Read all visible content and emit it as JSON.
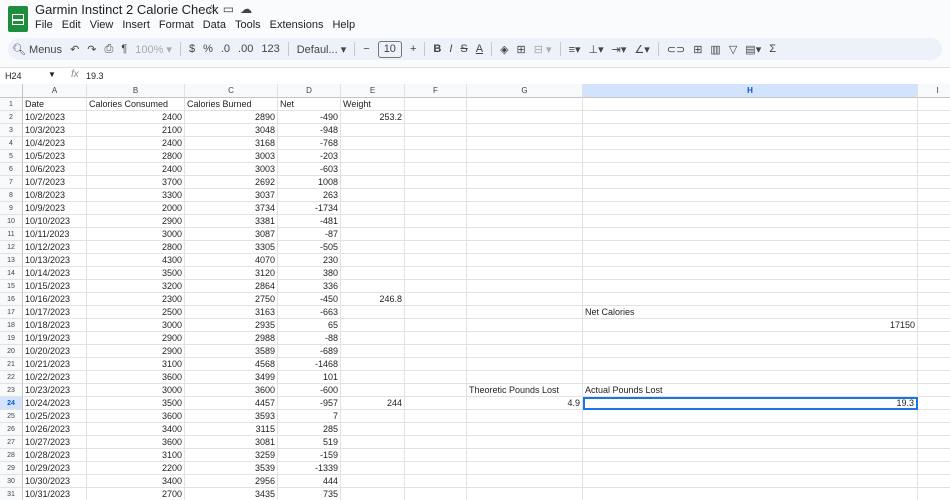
{
  "app": {
    "title": "Garmin Instinct 2 Calorie Check",
    "menu": [
      "File",
      "Edit",
      "View",
      "Insert",
      "Format",
      "Data",
      "Tools",
      "Extensions",
      "Help"
    ]
  },
  "toolbar": {
    "menus": "Menus",
    "zoom": "100%",
    "currency": "$",
    "percent": "%",
    "dec_decrease": ".0",
    "dec_increase": ".00",
    "number_format": "123",
    "font": "Defaul...",
    "minus": "−",
    "font_size": "10",
    "plus": "+",
    "bold": "B",
    "italic": "I",
    "strike": "S",
    "text_color": "A",
    "sum": "Σ"
  },
  "formula_bar": {
    "name_box": "H24",
    "fx": "fx",
    "value": "19.3"
  },
  "grid": {
    "columns": [
      "A",
      "B",
      "C",
      "D",
      "E",
      "F",
      "G",
      "H",
      "I"
    ],
    "selected_column": "H",
    "selected_row": "24",
    "rows": [
      {
        "n": "1",
        "A": "Date",
        "B": "Calories Consumed",
        "C": "Calories Burned",
        "D": "Net",
        "E": "Weight"
      },
      {
        "n": "2",
        "A": "10/2/2023",
        "B": "2400",
        "C": "2890",
        "D": "-490",
        "E": "253.2"
      },
      {
        "n": "3",
        "A": "10/3/2023",
        "B": "2100",
        "C": "3048",
        "D": "-948"
      },
      {
        "n": "4",
        "A": "10/4/2023",
        "B": "2400",
        "C": "3168",
        "D": "-768"
      },
      {
        "n": "5",
        "A": "10/5/2023",
        "B": "2800",
        "C": "3003",
        "D": "-203"
      },
      {
        "n": "6",
        "A": "10/6/2023",
        "B": "2400",
        "C": "3003",
        "D": "-603"
      },
      {
        "n": "7",
        "A": "10/7/2023",
        "B": "3700",
        "C": "2692",
        "D": "1008"
      },
      {
        "n": "8",
        "A": "10/8/2023",
        "B": "3300",
        "C": "3037",
        "D": "263"
      },
      {
        "n": "9",
        "A": "10/9/2023",
        "B": "2000",
        "C": "3734",
        "D": "-1734"
      },
      {
        "n": "10",
        "A": "10/10/2023",
        "B": "2900",
        "C": "3381",
        "D": "-481"
      },
      {
        "n": "11",
        "A": "10/11/2023",
        "B": "3000",
        "C": "3087",
        "D": "-87"
      },
      {
        "n": "12",
        "A": "10/12/2023",
        "B": "2800",
        "C": "3305",
        "D": "-505"
      },
      {
        "n": "13",
        "A": "10/13/2023",
        "B": "4300",
        "C": "4070",
        "D": "230"
      },
      {
        "n": "14",
        "A": "10/14/2023",
        "B": "3500",
        "C": "3120",
        "D": "380"
      },
      {
        "n": "15",
        "A": "10/15/2023",
        "B": "3200",
        "C": "2864",
        "D": "336"
      },
      {
        "n": "16",
        "A": "10/16/2023",
        "B": "2300",
        "C": "2750",
        "D": "-450",
        "E": "246.8"
      },
      {
        "n": "17",
        "A": "10/17/2023",
        "B": "2500",
        "C": "3163",
        "D": "-663",
        "H": "Net Calories"
      },
      {
        "n": "18",
        "A": "10/18/2023",
        "B": "3000",
        "C": "2935",
        "D": "65",
        "H": "17150"
      },
      {
        "n": "19",
        "A": "10/19/2023",
        "B": "2900",
        "C": "2988",
        "D": "-88"
      },
      {
        "n": "20",
        "A": "10/20/2023",
        "B": "2900",
        "C": "3589",
        "D": "-689"
      },
      {
        "n": "21",
        "A": "10/21/2023",
        "B": "3100",
        "C": "4568",
        "D": "-1468"
      },
      {
        "n": "22",
        "A": "10/22/2023",
        "B": "3600",
        "C": "3499",
        "D": "101"
      },
      {
        "n": "23",
        "A": "10/23/2023",
        "B": "3000",
        "C": "3600",
        "D": "-600",
        "G": "Theoretic Pounds Lost",
        "H": "Actual Pounds Lost"
      },
      {
        "n": "24",
        "A": "10/24/2023",
        "B": "3500",
        "C": "4457",
        "D": "-957",
        "E": "244",
        "G": "4.9",
        "H": "19.3"
      },
      {
        "n": "25",
        "A": "10/25/2023",
        "B": "3600",
        "C": "3593",
        "D": "7"
      },
      {
        "n": "26",
        "A": "10/26/2023",
        "B": "3400",
        "C": "3115",
        "D": "285"
      },
      {
        "n": "27",
        "A": "10/27/2023",
        "B": "3600",
        "C": "3081",
        "D": "519"
      },
      {
        "n": "28",
        "A": "10/28/2023",
        "B": "3100",
        "C": "3259",
        "D": "-159"
      },
      {
        "n": "29",
        "A": "10/29/2023",
        "B": "2200",
        "C": "3539",
        "D": "-1339"
      },
      {
        "n": "30",
        "A": "10/30/2023",
        "B": "3400",
        "C": "2956",
        "D": "444"
      },
      {
        "n": "31",
        "A": "10/31/2023",
        "B": "2700",
        "C": "3435",
        "D": "735"
      }
    ]
  }
}
